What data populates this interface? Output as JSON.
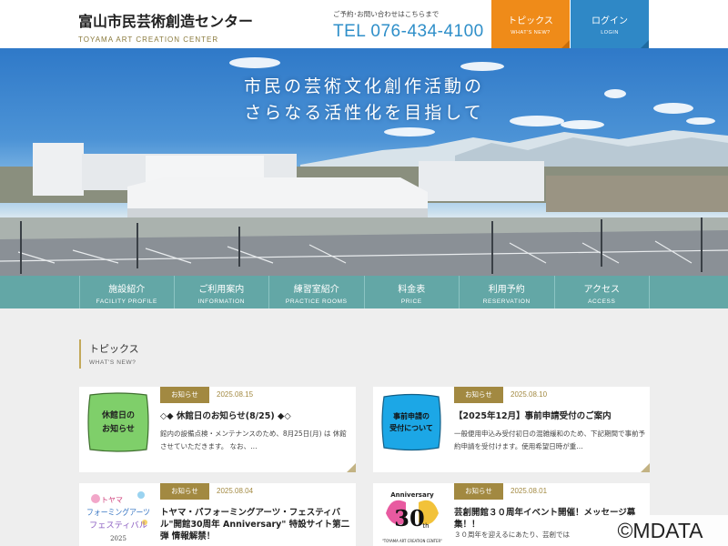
{
  "header": {
    "logo_jp": "富山市民芸術創造センター",
    "logo_en": "TOYAMA ART CREATION CENTER",
    "contact_note": "ご予約･お問い合わせはこちらまで",
    "tel": "TEL 076-434-4100",
    "topics_jp": "トピックス",
    "topics_en": "WHAT'S NEW?",
    "login_jp": "ログイン",
    "login_en": "LOGIN",
    "colors": {
      "topics": "#ef8b19",
      "login": "#2f88c6"
    }
  },
  "hero": {
    "line1": "市民の芸術文化創作活動の",
    "line2": "さらなる活性化を目指して"
  },
  "nav": {
    "items": [
      {
        "jp": "施設紹介",
        "en": "FACILITY PROFILE"
      },
      {
        "jp": "ご利用案内",
        "en": "INFORMATION"
      },
      {
        "jp": "練習室紹介",
        "en": "PRACTICE ROOMS"
      },
      {
        "jp": "料金表",
        "en": "PRICE"
      },
      {
        "jp": "利用予約",
        "en": "RESERVATION"
      },
      {
        "jp": "アクセス",
        "en": "ACCESS"
      }
    ],
    "color": "#63a7a6"
  },
  "topics": {
    "heading_jp": "トピックス",
    "heading_en": "WHAT'S NEW?",
    "cards": [
      {
        "tag": "お知らせ",
        "date": "2025.08.15",
        "title": "◇◆ 休館日のお知らせ(8/25) ◆◇",
        "body": "館内の設備点検・メンテナンスのため、8月25日(月) は 休館 させていただきます。 なお、…",
        "thumb_text_1": "休館日の",
        "thumb_text_2": "お知らせ"
      },
      {
        "tag": "お知らせ",
        "date": "2025.08.10",
        "title": "【2025年12月】事前申請受付のご案内",
        "body": "一般便用申込み受付初日の混雑緩和のため、下記期間で事前予約申請を受付けます。使用希望日時が重…",
        "thumb_text_1": "事前申請の",
        "thumb_text_2": "受付について"
      },
      {
        "tag": "お知らせ",
        "date": "2025.08.04",
        "title": "トヤマ・パフォーミングアーツ・フェスティバル\"開館30周年 Anniversary\" 特設サイト第二弾 情報解禁！",
        "body": "",
        "thumb_text_1": "トヤマ",
        "thumb_text_2": "フォーミングアーツ",
        "thumb_text_3": "フェスティバル",
        "thumb_text_4": "2025"
      },
      {
        "tag": "お知らせ",
        "date": "2025.08.01",
        "title": "芸創開館３０周年イベント開催！メッセージ募集！！",
        "body": "３０周年を迎えるにあたり、芸創では",
        "thumb_text_1": "Anniversary",
        "thumb_text_2": "30",
        "thumb_text_3": "th",
        "thumb_text_4": "\"TOYAMA ART CREATION CENTER\""
      }
    ],
    "tag_color": "#a28941"
  },
  "watermark": "©MDATA"
}
